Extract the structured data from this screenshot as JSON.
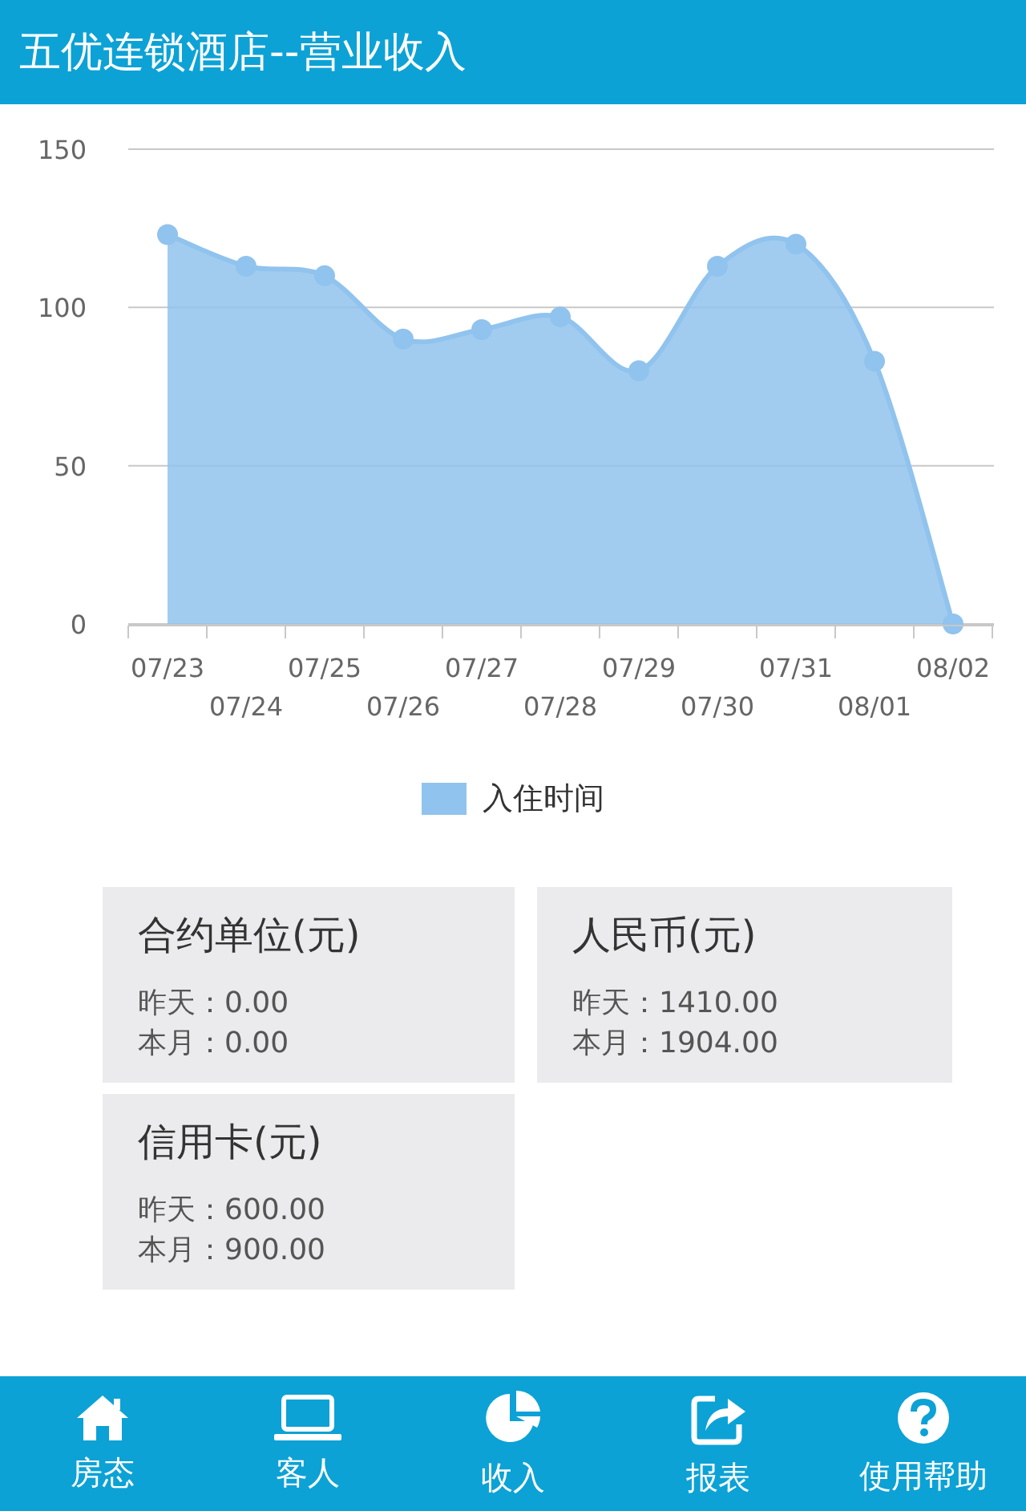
{
  "header": {
    "title": "五优连锁酒店--营业收入"
  },
  "chart": {
    "chart_data": {
      "type": "area",
      "categories": [
        "07/23",
        "07/24",
        "07/25",
        "07/26",
        "07/27",
        "07/28",
        "07/29",
        "07/30",
        "07/31",
        "08/01",
        "08/02"
      ],
      "series": [
        {
          "name": "入住时间",
          "color": "#90c3ed",
          "values": [
            123,
            113,
            110,
            90,
            93,
            97,
            80,
            113,
            120,
            83,
            0
          ]
        }
      ],
      "ylim": [
        0,
        150
      ],
      "yticks": [
        0,
        50,
        100,
        150
      ]
    }
  },
  "cards": [
    {
      "title": "合约单位(元)",
      "lines": [
        "昨天：0.00",
        "本月：0.00"
      ]
    },
    {
      "title": "人民币(元)",
      "lines": [
        "昨天：1410.00",
        "本月：1904.00"
      ]
    },
    {
      "title": "信用卡(元)",
      "lines": [
        "昨天：600.00",
        "本月：900.00"
      ]
    }
  ],
  "nav": [
    {
      "label": "房态",
      "kind": "house"
    },
    {
      "label": "客人",
      "kind": "laptop"
    },
    {
      "label": "收入",
      "kind": "pie"
    },
    {
      "label": "报表",
      "kind": "share"
    },
    {
      "label": "使用帮助",
      "kind": "help"
    }
  ]
}
